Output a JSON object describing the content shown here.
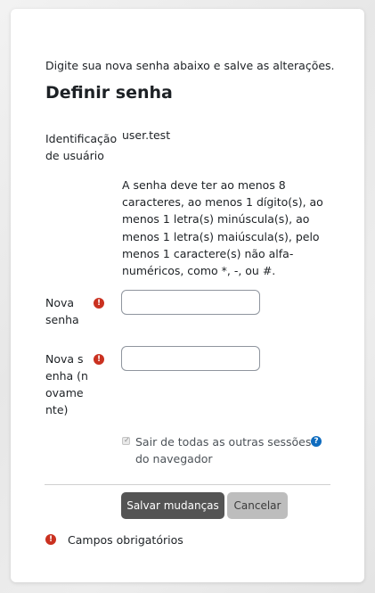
{
  "form": {
    "intro": "Digite sua nova senha abaixo e salve as alterações.",
    "title": "Definir senha",
    "username_label": "Identificação de usuário",
    "username_value": "user.test",
    "policy_text": "A senha deve ter ao menos 8 caracteres, ao menos 1 dígito(s), ao menos 1 letra(s) minúscula(s), ao menos 1 letra(s) maiúscula(s), pelo menos 1 caractere(s) não alfa-numéricos, como *, -, ou #.",
    "new_password_label": "Nova senha",
    "new_password_value": "",
    "confirm_password_label": "Nova senha (novamente)",
    "confirm_password_value": "",
    "logout_checkbox_label": "Sair de todas as outras sessões do navegador",
    "logout_checkbox_checked": true,
    "required_icon_glyph": "!",
    "help_icon_glyph": "?"
  },
  "buttons": {
    "save_label": "Salvar mudanças",
    "cancel_label": "Cancelar"
  },
  "footer": {
    "required_note": "Campos obrigatórios"
  },
  "colors": {
    "required_icon": "#ca3120",
    "help_icon": "#0f6cbf",
    "primary_button": "#545454",
    "secondary_button": "#bdbdbd"
  },
  "icons": {
    "required": "exclamation-circle-icon",
    "help": "question-circle-icon"
  }
}
